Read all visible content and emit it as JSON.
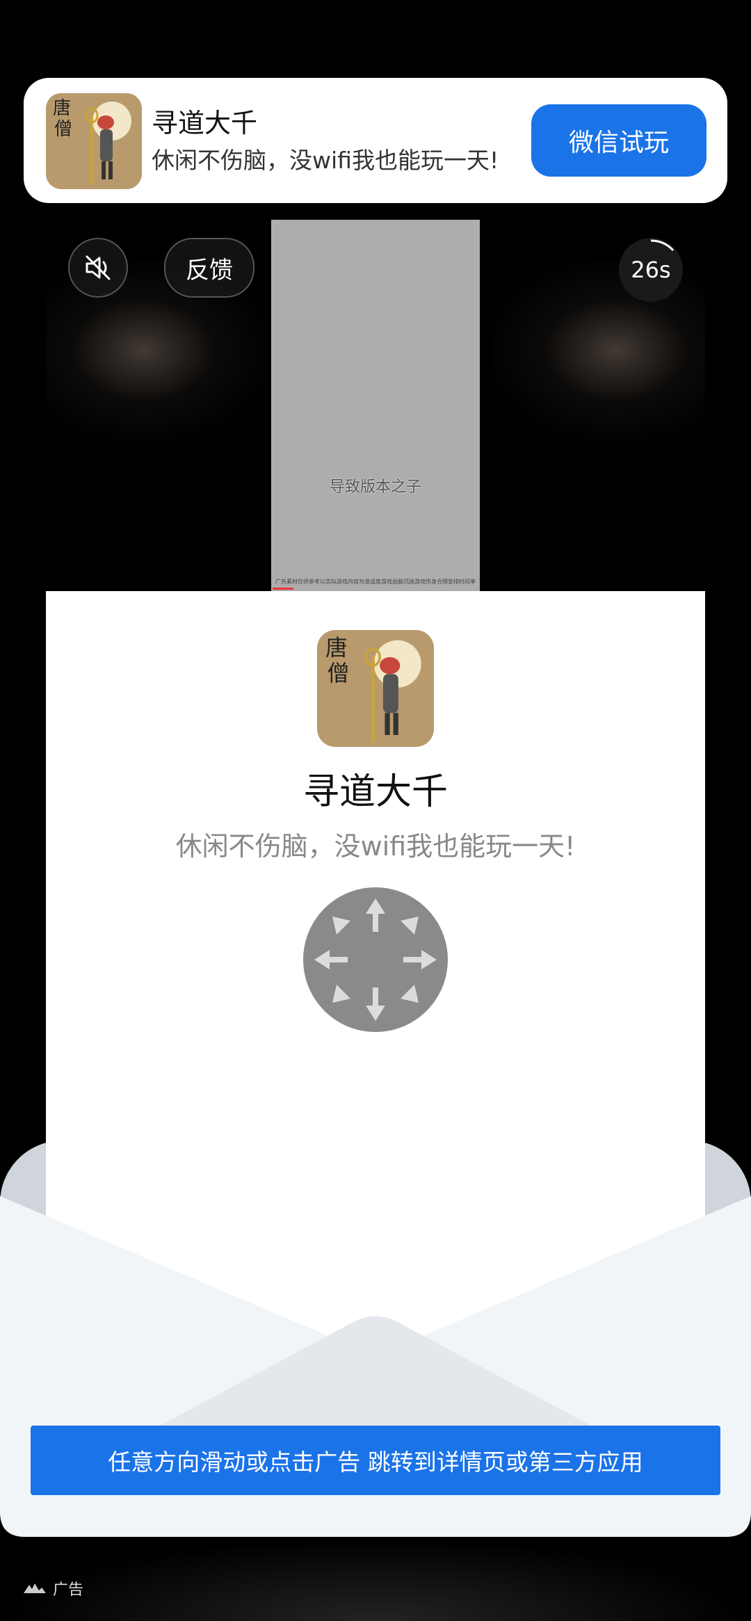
{
  "top_card": {
    "title": "寻道大千",
    "subtitle": "休闲不伤脑，没wifi我也能玩一天!",
    "try_button": "微信试玩"
  },
  "video": {
    "feedback_label": "反馈",
    "countdown": "26s",
    "caption": "导致版本之子",
    "legal_text": "广告素材仅供参考以实际游戏内容为准适度游戏益脑沉迷游戏伤身合理安排时间享受健康生活"
  },
  "main_card": {
    "title": "寻道大千",
    "subtitle": "休闲不伤脑，没wifi我也能玩一天!"
  },
  "cta": {
    "label": "任意方向滑动或点击广告 跳转到详情页或第三方应用"
  },
  "ad_badge": {
    "label": "广告"
  },
  "colors": {
    "accent": "#1b73e8",
    "icon_bg": "#b99a6d"
  }
}
